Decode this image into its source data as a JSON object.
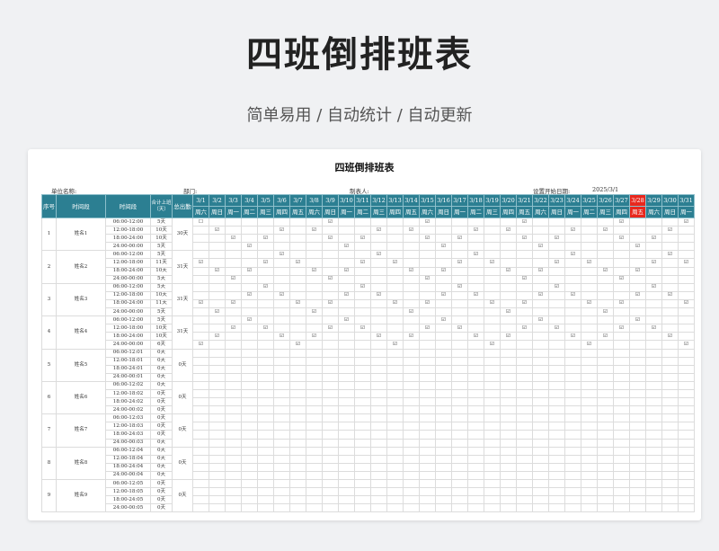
{
  "page": {
    "title": "四班倒排班表",
    "subtitle": "简单易用 / 自动统计 / 自动更新"
  },
  "sheet": {
    "title": "四班倒排班表",
    "unit_label": "单位名称:",
    "dept_label": "部门:",
    "maker_label": "制表人:",
    "start_label": "设置开始日期:",
    "start_value": "2025/3/1"
  },
  "header": {
    "seq": "序号",
    "period": "时间段",
    "slot": "时间段",
    "total": "合计上班（天）",
    "total_days": "总出勤"
  },
  "dates": [
    "3/1",
    "3/2",
    "3/3",
    "3/4",
    "3/5",
    "3/6",
    "3/7",
    "3/8",
    "3/9",
    "3/10",
    "3/11",
    "3/12",
    "3/13",
    "3/14",
    "3/15",
    "3/16",
    "3/17",
    "3/18",
    "3/19",
    "3/20",
    "3/21",
    "3/22",
    "3/23",
    "3/24",
    "3/25",
    "3/26",
    "3/27",
    "3/28",
    "3/29",
    "3/30",
    "3/31"
  ],
  "weekdays": [
    "周六",
    "周日",
    "周一",
    "周二",
    "周三",
    "周四",
    "周五",
    "周六",
    "周日",
    "周一",
    "周二",
    "周三",
    "周四",
    "周五",
    "周六",
    "周日",
    "周一",
    "周二",
    "周三",
    "周四",
    "周五",
    "周六",
    "周日",
    "周一",
    "周二",
    "周三",
    "周四",
    "周五",
    "周六",
    "周日",
    "周一"
  ],
  "highlight_index": 27,
  "colors": {
    "header": "#2c7f92",
    "highlight": "#e8271d"
  },
  "check_symbol": "☑",
  "empty_symbol": "☐",
  "rows": [
    {
      "no": "1",
      "name": "姓名1",
      "total_days": "30天",
      "shifts": [
        {
          "time": "06:00-12:00",
          "days": "5天",
          "marks": [
            -1,
            8,
            14,
            20,
            26,
            30
          ]
        },
        {
          "time": "12:00-18:00",
          "days": "10天",
          "marks": [
            1,
            5,
            7,
            11,
            13,
            17,
            19,
            23,
            25,
            29
          ]
        },
        {
          "time": "18:00-24:00",
          "days": "10天",
          "marks": [
            2,
            4,
            8,
            10,
            14,
            16,
            20,
            22,
            26,
            28
          ]
        },
        {
          "time": "24:00-00:00",
          "days": "5天",
          "marks": [
            3,
            9,
            15,
            21,
            27
          ]
        }
      ]
    },
    {
      "no": "2",
      "name": "姓名2",
      "total_days": "31天",
      "shifts": [
        {
          "time": "06:00-12:00",
          "days": "5天",
          "marks": [
            5,
            11,
            17,
            23,
            29
          ]
        },
        {
          "time": "12:00-18:00",
          "days": "11天",
          "marks": [
            0,
            4,
            6,
            10,
            12,
            16,
            18,
            22,
            24,
            28,
            30
          ]
        },
        {
          "time": "18:00-24:00",
          "days": "10天",
          "marks": [
            1,
            3,
            7,
            9,
            13,
            15,
            19,
            21,
            25,
            27
          ]
        },
        {
          "time": "24:00-00:00",
          "days": "5天",
          "marks": [
            2,
            8,
            14,
            20,
            26
          ]
        }
      ]
    },
    {
      "no": "3",
      "name": "姓名3",
      "total_days": "31天",
      "shifts": [
        {
          "time": "06:00-12:00",
          "days": "5天",
          "marks": [
            4,
            10,
            16,
            22,
            28
          ]
        },
        {
          "time": "12:00-18:00",
          "days": "10天",
          "marks": [
            3,
            5,
            9,
            11,
            15,
            17,
            21,
            23,
            27,
            29
          ]
        },
        {
          "time": "18:00-24:00",
          "days": "11天",
          "marks": [
            0,
            2,
            6,
            8,
            12,
            14,
            18,
            20,
            24,
            26,
            30
          ]
        },
        {
          "time": "24:00-00:00",
          "days": "5天",
          "marks": [
            1,
            7,
            13,
            19,
            25
          ]
        }
      ]
    },
    {
      "no": "4",
      "name": "姓名4",
      "total_days": "31天",
      "shifts": [
        {
          "time": "06:00-12:00",
          "days": "5天",
          "marks": [
            3,
            9,
            15,
            21,
            27
          ]
        },
        {
          "time": "12:00-18:00",
          "days": "10天",
          "marks": [
            2,
            4,
            8,
            10,
            14,
            16,
            20,
            22,
            26,
            28
          ]
        },
        {
          "time": "18:00-24:00",
          "days": "10天",
          "marks": [
            1,
            5,
            7,
            11,
            13,
            17,
            19,
            23,
            25,
            29
          ]
        },
        {
          "time": "24:00-00:00",
          "days": "6天",
          "marks": [
            0,
            6,
            12,
            18,
            24,
            30
          ]
        }
      ]
    },
    {
      "no": "5",
      "name": "姓名5",
      "total_days": "0天",
      "shifts": [
        {
          "time": "06:00-12:01",
          "days": "0天",
          "marks": []
        },
        {
          "time": "12:00-18:01",
          "days": "0天",
          "marks": []
        },
        {
          "time": "18:00-24:01",
          "days": "0天",
          "marks": []
        },
        {
          "time": "24:00-00:01",
          "days": "0天",
          "marks": []
        }
      ]
    },
    {
      "no": "6",
      "name": "姓名6",
      "total_days": "0天",
      "shifts": [
        {
          "time": "06:00-12:02",
          "days": "0天",
          "marks": []
        },
        {
          "time": "12:00-18:02",
          "days": "0天",
          "marks": []
        },
        {
          "time": "18:00-24:02",
          "days": "0天",
          "marks": []
        },
        {
          "time": "24:00-00:02",
          "days": "0天",
          "marks": []
        }
      ]
    },
    {
      "no": "7",
      "name": "姓名7",
      "total_days": "0天",
      "shifts": [
        {
          "time": "06:00-12:03",
          "days": "0天",
          "marks": []
        },
        {
          "time": "12:00-18:03",
          "days": "0天",
          "marks": []
        },
        {
          "time": "18:00-24:03",
          "days": "0天",
          "marks": []
        },
        {
          "time": "24:00-00:03",
          "days": "0天",
          "marks": []
        }
      ]
    },
    {
      "no": "8",
      "name": "姓名8",
      "total_days": "0天",
      "shifts": [
        {
          "time": "06:00-12:04",
          "days": "0天",
          "marks": []
        },
        {
          "time": "12:00-18:04",
          "days": "0天",
          "marks": []
        },
        {
          "time": "18:00-24:04",
          "days": "0天",
          "marks": []
        },
        {
          "time": "24:00-00:04",
          "days": "0天",
          "marks": []
        }
      ]
    },
    {
      "no": "9",
      "name": "姓名9",
      "total_days": "0天",
      "shifts": [
        {
          "time": "06:00-12:05",
          "days": "0天",
          "marks": []
        },
        {
          "time": "12:00-18:05",
          "days": "0天",
          "marks": []
        },
        {
          "time": "18:00-24:05",
          "days": "0天",
          "marks": []
        },
        {
          "time": "24:00-00:05",
          "days": "0天",
          "marks": []
        }
      ]
    }
  ]
}
